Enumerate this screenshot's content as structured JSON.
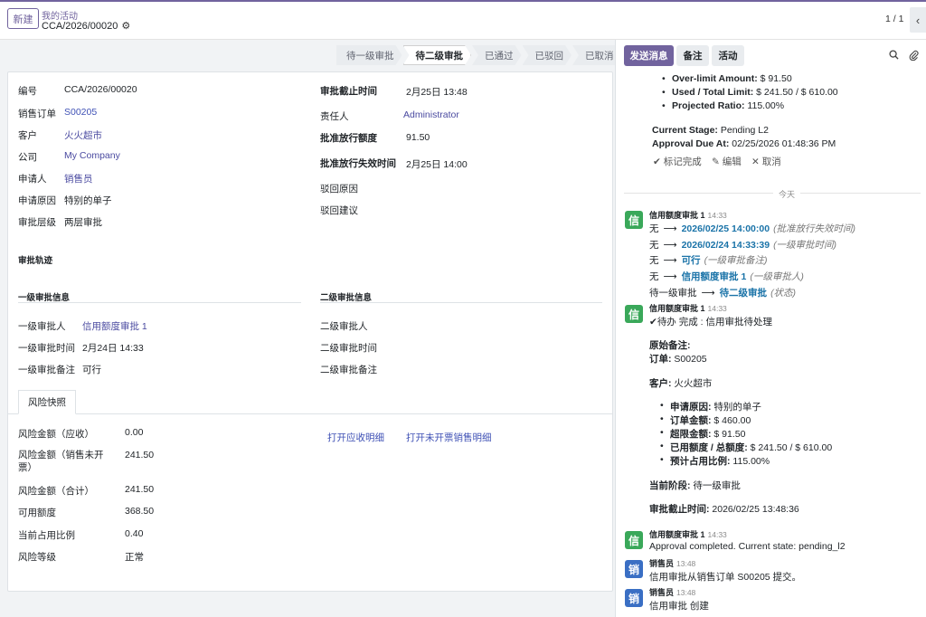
{
  "control_panel": {
    "new_button": "新建",
    "breadcrumb_parent": "我的活动",
    "record_name": "CCA/2026/00020",
    "pager": "1 / 1"
  },
  "statusbar": [
    "待一级审批",
    "待二级审批",
    "已通过",
    "已驳回",
    "已取消"
  ],
  "form": {
    "left": [
      {
        "label": "编号",
        "value": "CCA/2026/00020"
      },
      {
        "label": "销售订单",
        "value": "S00205"
      },
      {
        "label": "客户",
        "value": "火火超市"
      },
      {
        "label": "公司",
        "value": "My Company"
      },
      {
        "label": "申请人",
        "value": "销售员"
      },
      {
        "label": "申请原因",
        "value": "特别的单子"
      },
      {
        "label": "审批层级",
        "value": "两层审批"
      }
    ],
    "right": [
      {
        "label": "审批截止时间",
        "value": "2月25日 13:48"
      },
      {
        "label": "责任人",
        "value": "Administrator"
      },
      {
        "label": "批准放行额度",
        "value": "91.50"
      },
      {
        "label": "批准放行失效时间",
        "value": "2月25日 14:00"
      },
      {
        "label": "驳回原因",
        "value": ""
      },
      {
        "label": "驳回建议",
        "value": ""
      }
    ],
    "track_title": "审批轨迹",
    "level1_title": "一级审批信息",
    "level2_title": "二级审批信息",
    "level1": [
      {
        "label": "一级审批人",
        "value": "信用额度审批 1"
      },
      {
        "label": "一级审批时间",
        "value": "2月24日 14:33"
      },
      {
        "label": "一级审批备注",
        "value": "可行"
      }
    ],
    "level2": [
      {
        "label": "二级审批人",
        "value": ""
      },
      {
        "label": "二级审批时间",
        "value": ""
      },
      {
        "label": "二级审批备注",
        "value": ""
      }
    ],
    "tab_risk": "风险快照",
    "risk": [
      {
        "label": "风险金额（应收）",
        "value": "0.00"
      },
      {
        "label": "风险金额（销售未开票）",
        "value": "241.50"
      },
      {
        "label": "风险金额（合计）",
        "value": "241.50"
      },
      {
        "label": "可用额度",
        "value": "368.50"
      },
      {
        "label": "当前占用比例",
        "value": "0.40"
      },
      {
        "label": "风险等级",
        "value": "正常"
      }
    ],
    "open_receivable": "打开应收明细",
    "open_uninvoiced": "打开未开票销售明细"
  },
  "chatter": {
    "send_message": "发送消息",
    "log_note": "备注",
    "activity": "活动",
    "top_bullets": [
      {
        "label": "Over-limit Amount:",
        "value": " $ 91.50"
      },
      {
        "label": "Used / Total Limit:",
        "value": " $ 241.50 / $ 610.00"
      },
      {
        "label": "Projected Ratio:",
        "value": " 115.00%"
      }
    ],
    "current_stage_label": "Current Stage:",
    "current_stage_value": " Pending L2",
    "due_label": "Approval Due At:",
    "due_value": " 02/25/2026 01:48:36 PM",
    "mark_done": "标记完成",
    "edit": "编辑",
    "cancel": "取消",
    "today": "今天",
    "msg1": {
      "avatar": "信",
      "author": "信用额度审批 1",
      "time": "14:33",
      "tracking": [
        {
          "old": "无",
          "new": "2026/02/25 14:00:00",
          "field": "(批准放行失效时间)"
        },
        {
          "old": "无",
          "new": "2026/02/24 14:33:39",
          "field": "(一级审批时间)"
        },
        {
          "old": "无",
          "new": "可行",
          "field": "(一级审批备注)"
        },
        {
          "old": "无",
          "new": "信用额度审批 1",
          "field": "(一级审批人)"
        },
        {
          "old": "待一级审批",
          "new": "待二级审批",
          "field": "(状态)"
        }
      ]
    },
    "msg2": {
      "avatar": "信",
      "author": "信用额度审批 1",
      "time": "14:33",
      "done_line": "待办 完成 : 信用审批待处理",
      "orig_note": "原始备注:",
      "order_label": "订单:",
      "order_value": " S00205",
      "customer_label": "客户:",
      "customer_value": " 火火超市",
      "bullets": [
        {
          "label": "申请原因:",
          "value": " 特别的单子"
        },
        {
          "label": "订单金额:",
          "value": " $ 460.00"
        },
        {
          "label": "超限金额:",
          "value": " $ 91.50"
        },
        {
          "label": "已用额度 / 总额度:",
          "value": " $ 241.50 / $ 610.00"
        },
        {
          "label": "预计占用比例:",
          "value": " 115.00%"
        }
      ],
      "stage_label": "当前阶段:",
      "stage_value": " 待一级审批",
      "deadline_label": "审批截止时间:",
      "deadline_value": " 2026/02/25 13:48:36"
    },
    "msg3": {
      "avatar": "信",
      "author": "信用额度审批 1",
      "time": "14:33",
      "body": "Approval completed. Current state: pending_l2"
    },
    "msg4": {
      "avatar": "销",
      "author": "销售员",
      "time": "13:48",
      "body": "信用审批从销售订单 S00205 提交。"
    },
    "msg5": {
      "avatar": "销",
      "author": "销售员",
      "time": "13:48",
      "body": "信用审批 创建"
    }
  },
  "colors": {
    "brand": "#71639e",
    "link": "#3f51b5",
    "tracking_value": "#1a73a8",
    "avatar_green": "#3aa85a",
    "avatar_blue": "#3a6fc4"
  }
}
